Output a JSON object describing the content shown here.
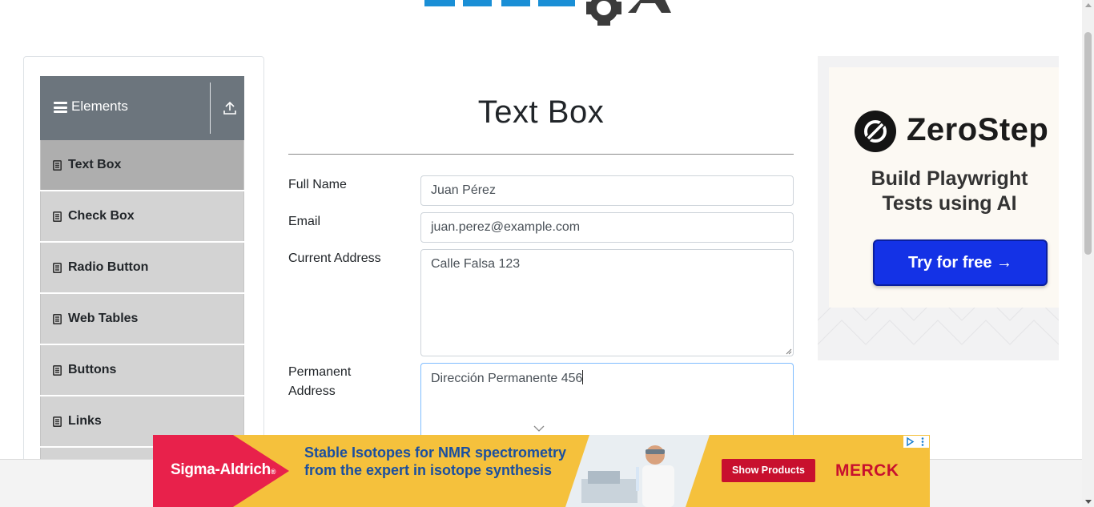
{
  "sidebar": {
    "group_title": "Elements",
    "items": [
      {
        "label": "Text Box",
        "active": true
      },
      {
        "label": "Check Box"
      },
      {
        "label": "Radio Button"
      },
      {
        "label": "Web Tables"
      },
      {
        "label": "Buttons"
      },
      {
        "label": "Links"
      }
    ]
  },
  "main": {
    "title": "Text Box",
    "fields": {
      "full_name": {
        "label": "Full Name",
        "value": "Juan Pérez"
      },
      "email": {
        "label": "Email",
        "value": "juan.perez@example.com"
      },
      "current_address": {
        "label": "Current Address",
        "value": "Calle Falsa 123"
      },
      "permanent_address": {
        "label_line1": "Permanent",
        "label_line2": "Address",
        "value": "Dirección Permanente 456"
      }
    }
  },
  "ad_right": {
    "brand": "ZeroStep",
    "tagline_line1": "Build Playwright",
    "tagline_line2": "Tests using AI",
    "cta": "Try for free →"
  },
  "ad_bottom": {
    "brand_left": "Sigma-Aldrich",
    "brand_left_mark": "®",
    "headline": "Stable Isotopes for NMR spectrometry from the expert in isotope synthesis",
    "button": "Show Products",
    "brand_right": "MERCK"
  },
  "colors": {
    "sidebar_header": "#6c757d",
    "menu_item": "#d3d3d3",
    "menu_item_active": "#aeaeae",
    "cta_blue": "#1432e6",
    "ad_bottom_yellow": "#f5c13c",
    "merck_red": "#c8102e"
  },
  "icons": [
    "menu-icon",
    "collapse-up-icon",
    "document-icon",
    "zerostep-logo-icon",
    "chevron-down-icon",
    "ad-choices-icon"
  ]
}
